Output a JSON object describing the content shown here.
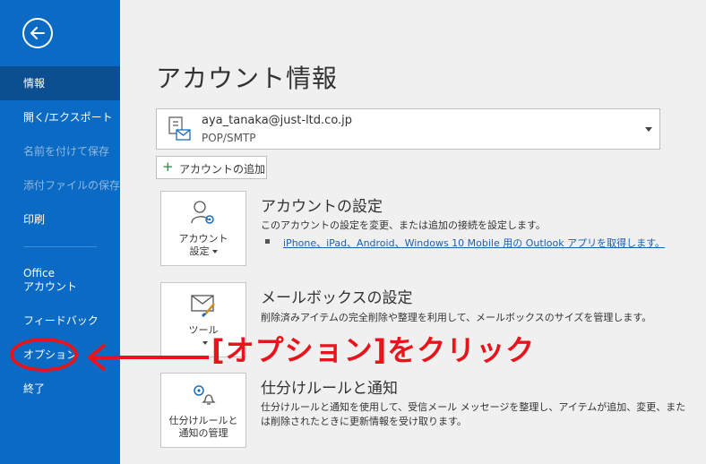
{
  "sidebar": {
    "items": [
      {
        "label": "情報"
      },
      {
        "label": "開く/エクスポート"
      },
      {
        "label": "名前を付けて保存"
      },
      {
        "label": "添付ファイルの保存"
      },
      {
        "label": "印刷"
      },
      {
        "label_line1": "Office",
        "label_line2": "アカウント"
      },
      {
        "label": "フィードバック"
      },
      {
        "label": "オプション"
      },
      {
        "label": "終了"
      }
    ]
  },
  "main": {
    "title": "アカウント情報",
    "account": {
      "email": "aya_tanaka@just-ltd.co.jp",
      "type": "POP/SMTP"
    },
    "add_account_label": "アカウントの追加",
    "sections": [
      {
        "tile_line1": "アカウント",
        "tile_line2": "設定",
        "title": "アカウントの設定",
        "desc": "このアカウントの設定を変更、または追加の接続を設定します。",
        "link": "iPhone、iPad、Android、Windows 10 Mobile 用の Outlook アプリを取得します。"
      },
      {
        "tile_line1": "ツール",
        "title": "メールボックスの設定",
        "desc": "削除済みアイテムの完全削除や整理を利用して、メールボックスのサイズを管理します。"
      },
      {
        "tile_line1": "仕分けルールと",
        "tile_line2": "通知の管理",
        "title": "仕分けルールと通知",
        "desc_line1": "仕分けルールと通知を使用して、受信メール メッセージを整理し、アイテムが追加、変更、また",
        "desc_line2": "は削除されたときに更新情報を受け取ります。"
      }
    ]
  },
  "annotation": {
    "text": "[オプション]をクリック",
    "color": "#e8141c"
  },
  "colors": {
    "sidebar": "#0b6ac3",
    "sidebar_selected": "#0b4f91",
    "link": "#1a5fb4"
  },
  "icons": [
    "back-arrow-icon",
    "mailbox-icon",
    "account-settings-icon",
    "tools-icon",
    "rules-alert-icon",
    "plus-icon",
    "chevron-down-icon"
  ]
}
